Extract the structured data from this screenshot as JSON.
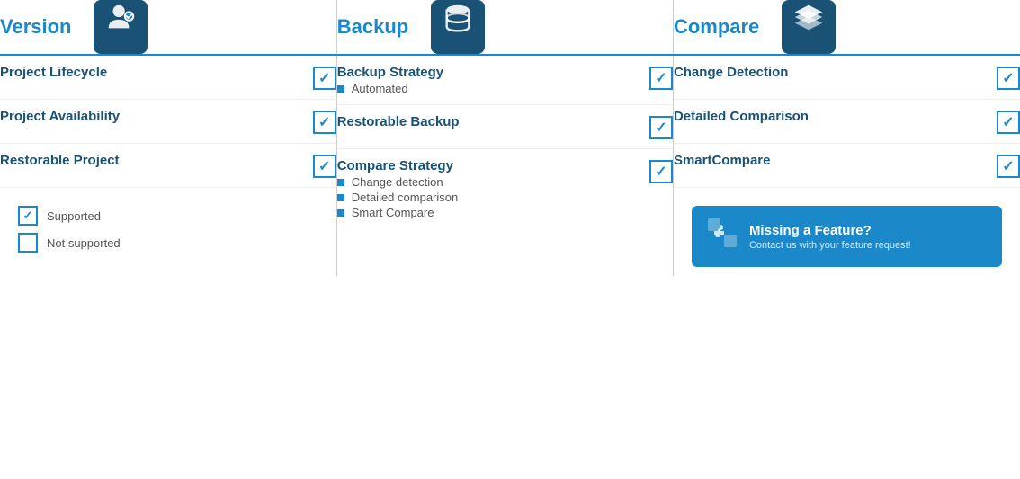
{
  "columns": {
    "version": {
      "title": "Version",
      "icon_name": "version-icon",
      "features": [
        {
          "name": "Project Lifecycle",
          "checked": true,
          "sub_items": []
        },
        {
          "name": "Project Availability",
          "checked": true,
          "sub_items": []
        },
        {
          "name": "Restorable Project",
          "checked": true,
          "sub_items": []
        }
      ]
    },
    "backup": {
      "title": "Backup",
      "icon_name": "backup-icon",
      "features": [
        {
          "name": "Backup Strategy",
          "checked": true,
          "sub_items": [
            "Automated"
          ]
        },
        {
          "name": "Restorable Backup",
          "checked": true,
          "sub_items": []
        },
        {
          "name": "Compare Strategy",
          "checked": true,
          "sub_items": [
            "Change detection",
            "Detailed comparison",
            "Smart Compare"
          ]
        }
      ]
    },
    "compare": {
      "title": "Compare",
      "icon_name": "compare-icon",
      "features": [
        {
          "name": "Change Detection",
          "checked": true,
          "sub_items": []
        },
        {
          "name": "Detailed Comparison",
          "checked": true,
          "sub_items": []
        },
        {
          "name": "SmartCompare",
          "checked": true,
          "sub_items": []
        }
      ]
    }
  },
  "legend": {
    "supported": {
      "label": "Supported",
      "checked": true
    },
    "not_supported": {
      "label": "Not supported",
      "checked": false
    }
  },
  "banner": {
    "title": "Missing a Feature?",
    "subtitle": "Contact us with your feature request!"
  },
  "colors": {
    "accent": "#1a88c9",
    "dark_blue": "#1a5276"
  }
}
